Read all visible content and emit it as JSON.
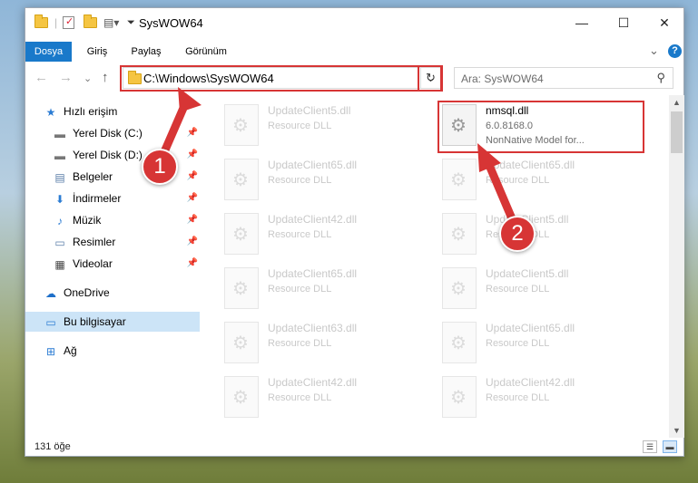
{
  "window": {
    "title": "SysWOW64",
    "quick_access_icons": [
      "folder-icon",
      "properties-icon",
      "new-folder-icon",
      "customize-icon"
    ],
    "controls": {
      "minimize": "—",
      "maximize": "☐",
      "close": "✕"
    }
  },
  "ribbon": {
    "tabs": [
      {
        "label": "Dosya",
        "active": true
      },
      {
        "label": "Giriş",
        "active": false
      },
      {
        "label": "Paylaş",
        "active": false
      },
      {
        "label": "Görünüm",
        "active": false
      }
    ],
    "expand_icon": "⌄",
    "help": "?"
  },
  "navbar": {
    "back": "←",
    "forward": "→",
    "recent": "⌄",
    "up": "↑",
    "address": "C:\\Windows\\SysWOW64",
    "address_dropdown": "⌄",
    "refresh": "↻",
    "search_placeholder": "Ara: SysWOW64",
    "search_icon": "⚲"
  },
  "sidebar": {
    "items": [
      {
        "label": "Hızlı erişim",
        "icon": "★",
        "pinned": false
      },
      {
        "label": "Yerel Disk (C:)",
        "icon": "▬",
        "pinned": true
      },
      {
        "label": "Yerel Disk (D:)",
        "icon": "▬",
        "pinned": true
      },
      {
        "label": "Belgeler",
        "icon": "▤",
        "pinned": true
      },
      {
        "label": "İndirmeler",
        "icon": "⬇",
        "pinned": true
      },
      {
        "label": "Müzik",
        "icon": "♪",
        "pinned": true
      },
      {
        "label": "Resimler",
        "icon": "▭",
        "pinned": true
      },
      {
        "label": "Videolar",
        "icon": "▦",
        "pinned": true
      },
      {
        "label": "OneDrive",
        "icon": "☁",
        "pinned": false
      },
      {
        "label": "Bu bilgisayar",
        "icon": "▭",
        "pinned": false,
        "selected": true
      },
      {
        "label": "Ağ",
        "icon": "⊞",
        "pinned": false
      }
    ],
    "pin_icon": "📌"
  },
  "files": {
    "left_column": [
      {
        "name": "UpdateClient5.dll",
        "type": "Resource DLL"
      },
      {
        "name": "UpdateClient65.dll",
        "type": "Resource DLL"
      },
      {
        "name": "UpdateClient42.dll",
        "type": "Resource DLL"
      },
      {
        "name": "UpdateClient65.dll",
        "type": "Resource DLL"
      },
      {
        "name": "UpdateClient63.dll",
        "type": "Resource DLL"
      },
      {
        "name": "UpdateClient42.dll",
        "type": "Resource DLL"
      }
    ],
    "highlighted": {
      "name": "nmsql.dll",
      "version": "6.0.8168.0",
      "description": "NonNative Model for..."
    },
    "right_column": [
      {
        "name": "UpdateClient65.dll",
        "type": "Resource DLL"
      },
      {
        "name": "UpdateClient5.dll",
        "type": "Resource DLL"
      },
      {
        "name": "UpdateClient5.dll",
        "type": "Resource DLL"
      },
      {
        "name": "UpdateClient65.dll",
        "type": "Resource DLL"
      },
      {
        "name": "UpdateClient42.dll",
        "type": "Resource DLL"
      }
    ]
  },
  "statusbar": {
    "count": "131 öğe"
  },
  "callouts": {
    "first": "1",
    "second": "2",
    "color": "#d73535"
  }
}
